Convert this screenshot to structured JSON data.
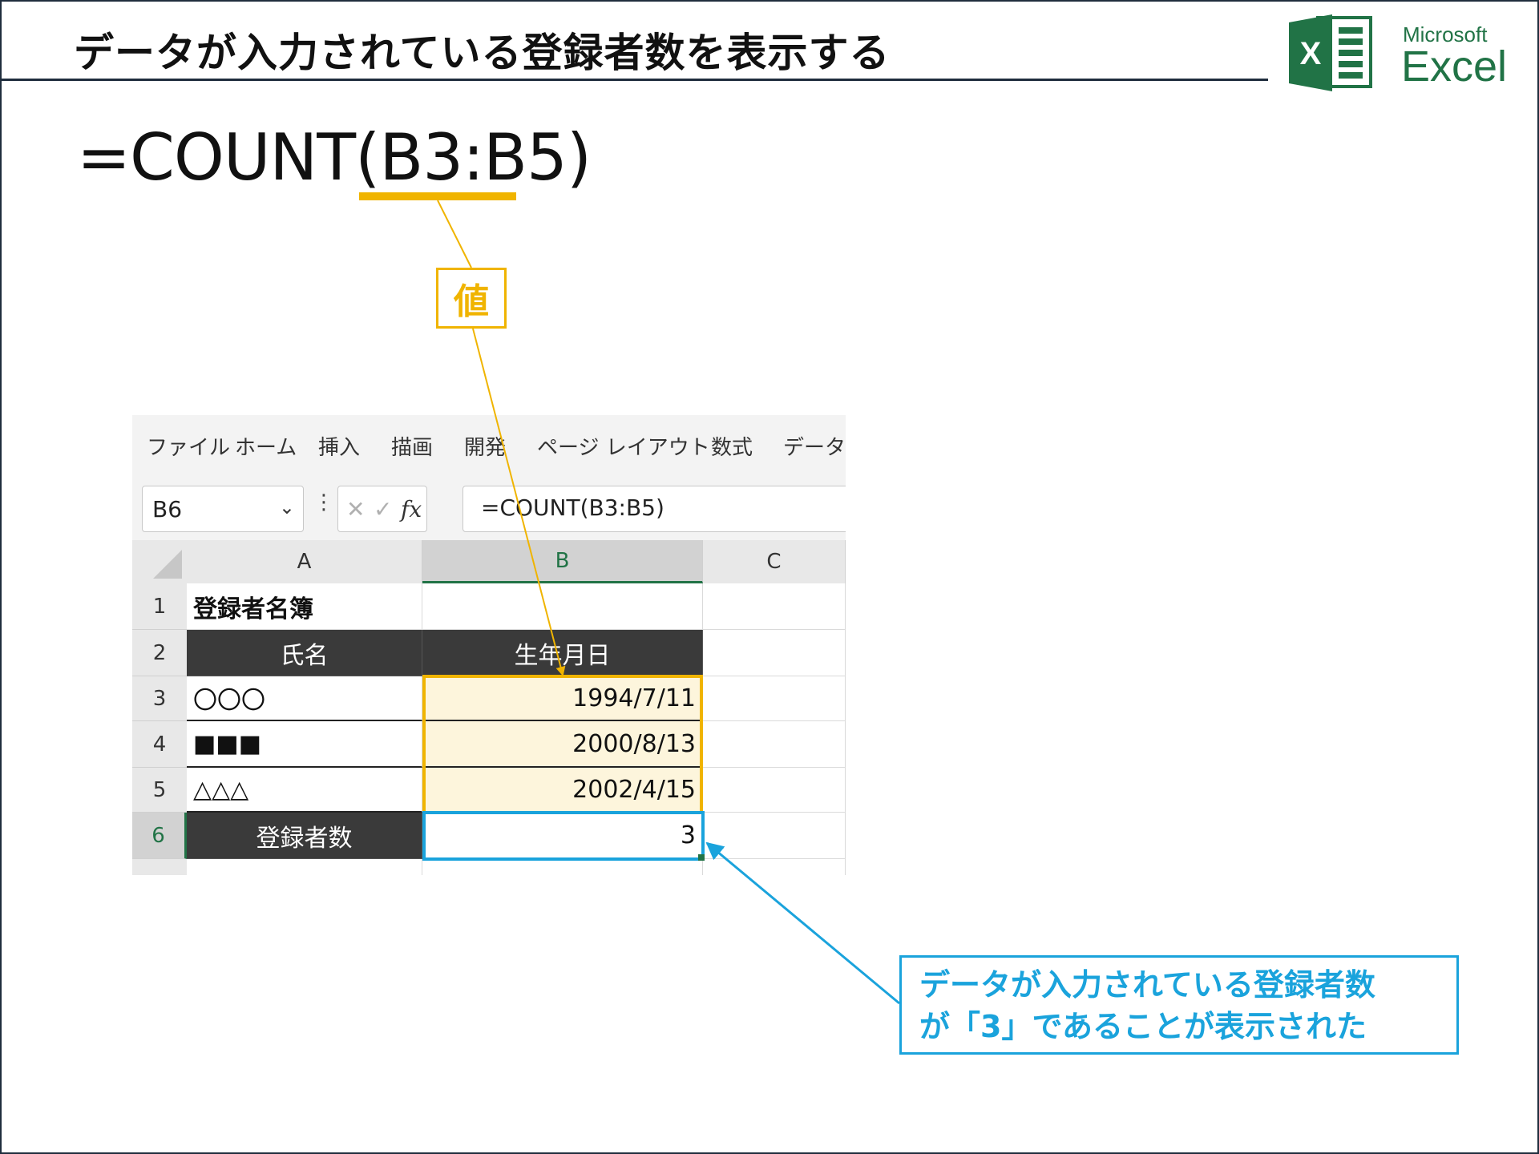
{
  "slide": {
    "title": "データが入力されている登録者数を表示する",
    "formula": "=COUNT(B3:B5)",
    "value_label": "値",
    "callout_line1": "データが入力されている登録者数",
    "callout_line2": "が「3」であることが表示された"
  },
  "logo": {
    "microsoft": "Microsoft",
    "excel": "Excel",
    "icon_letter": "X",
    "icon": "excel-logo-icon"
  },
  "ribbon": {
    "tabs": [
      "ファイル",
      "ホーム",
      "挿入",
      "描画",
      "開発",
      "ページ レイアウト",
      "数式",
      "データ"
    ]
  },
  "formula_bar": {
    "name_box": "B6",
    "cancel_icon": "✕",
    "enter_icon": "✓",
    "fx_label": "fx",
    "formula": "=COUNT(B3:B5)"
  },
  "sheet": {
    "columns": [
      "A",
      "B",
      "C"
    ],
    "rows": [
      "1",
      "2",
      "3",
      "4",
      "5",
      "6"
    ],
    "cells": {
      "A1": "登録者名簿",
      "A2": "氏名",
      "B2": "生年月日",
      "A3": "〇〇〇",
      "B3": "1994/7/11",
      "A4": "■■■",
      "B4": "2000/8/13",
      "A5": "△△△",
      "B5": "2002/4/15",
      "A6": "登録者数",
      "B6": "3"
    }
  },
  "colors": {
    "accent_yellow": "#f0b400",
    "accent_blue": "#1aa3dc",
    "excel_green": "#217346",
    "header_dark": "#3a3a3a",
    "range_fill": "#fdf5dc"
  }
}
